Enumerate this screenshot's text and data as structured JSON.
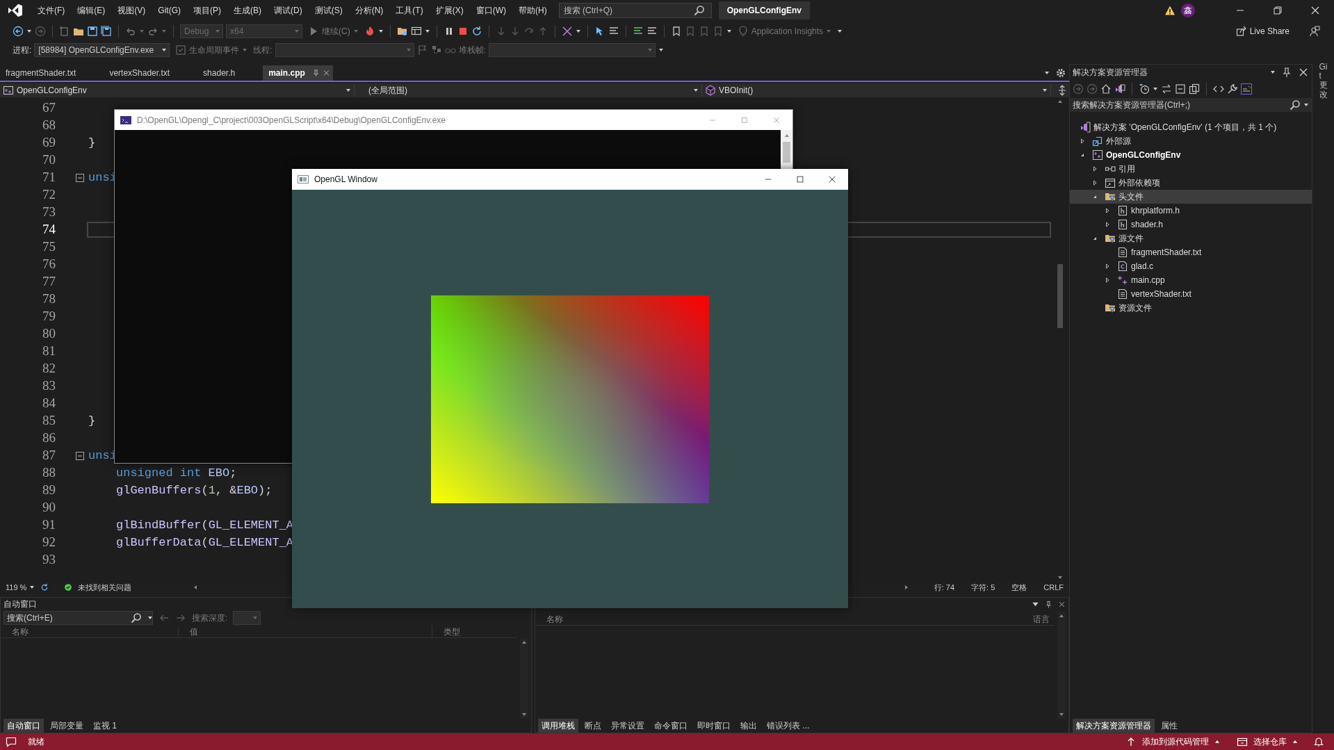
{
  "menu_bar": {
    "menus": [
      "文件(F)",
      "编辑(E)",
      "视图(V)",
      "Git(G)",
      "项目(P)",
      "生成(B)",
      "调试(D)",
      "测试(S)",
      "分析(N)",
      "工具(T)",
      "扩展(X)",
      "窗口(W)",
      "帮助(H)"
    ],
    "search": {
      "placeholder": "搜索 (Ctrl+Q)"
    },
    "solution_name": "OpenGLConfigEnv",
    "avatar": "鑫"
  },
  "toolbar": {
    "configuration": "Debug",
    "platform": "x64",
    "continue_button": "继续(C)",
    "insights": "Application Insights",
    "live_share": "Live Share"
  },
  "debug_location": {
    "process_label": "进程:",
    "process": "[58984] OpenGLConfigEnv.exe",
    "lifecycle_events": "生命周期事件",
    "thread_label": "线程:",
    "stack_frame_label": "堆栈帧:"
  },
  "tabs": [
    {
      "label": "fragmentShader.txt",
      "selected": false
    },
    {
      "label": "vertexShader.txt",
      "selected": false
    },
    {
      "label": "shader.h",
      "selected": false
    },
    {
      "label": "main.cpp",
      "selected": true
    }
  ],
  "navigation": {
    "project": "OpenGLConfigEnv",
    "scope": "(全局范围)",
    "member": "VBOInit()"
  },
  "editor": {
    "lines": [
      {
        "number": "67",
        "kind": "blank"
      },
      {
        "number": "68",
        "kind": "blank"
      },
      {
        "number": "69",
        "kind": "brace",
        "tokens": [
          {
            "text": "}",
            "kind": "punct"
          }
        ]
      },
      {
        "number": "70",
        "kind": "blank"
      },
      {
        "number": "71",
        "kind": "fold_start",
        "tokens": [
          {
            "text": "unsi",
            "kind": "keyword"
          }
        ]
      },
      {
        "number": "72",
        "kind": "blank"
      },
      {
        "number": "73",
        "kind": "blank"
      },
      {
        "number": "74",
        "kind": "current"
      },
      {
        "number": "75",
        "kind": "blank"
      },
      {
        "number": "76",
        "kind": "blank"
      },
      {
        "number": "77",
        "kind": "blank"
      },
      {
        "number": "78",
        "kind": "blank"
      },
      {
        "number": "79",
        "kind": "blank"
      },
      {
        "number": "80",
        "kind": "blank"
      },
      {
        "number": "81",
        "kind": "blank"
      },
      {
        "number": "82",
        "kind": "blank"
      },
      {
        "number": "83",
        "kind": "blank"
      },
      {
        "number": "84",
        "kind": "blank"
      },
      {
        "number": "85",
        "kind": "brace",
        "tokens": [
          {
            "text": "}",
            "kind": "punct"
          }
        ]
      },
      {
        "number": "86",
        "kind": "blank"
      },
      {
        "number": "87",
        "kind": "fold_start",
        "tokens": [
          {
            "text": "unsi",
            "kind": "keyword"
          }
        ]
      },
      {
        "number": "88",
        "kind": "body",
        "tokens": [
          {
            "text": "unsigned int",
            "kind": "keyword"
          },
          {
            "text": " EBO",
            "kind": "variable"
          },
          {
            "text": ";",
            "kind": "punct"
          }
        ]
      },
      {
        "number": "89",
        "kind": "body",
        "tokens": [
          {
            "text": "glGenBuffers",
            "kind": "function"
          },
          {
            "text": "(",
            "kind": "punct"
          },
          {
            "text": "1",
            "kind": "number"
          },
          {
            "text": ", &",
            "kind": "punct"
          },
          {
            "text": "EBO",
            "kind": "variable"
          },
          {
            "text": ");",
            "kind": "punct"
          }
        ]
      },
      {
        "number": "90",
        "kind": "blank"
      },
      {
        "number": "91",
        "kind": "body",
        "tokens": [
          {
            "text": "glBindBuffer",
            "kind": "function"
          },
          {
            "text": "(",
            "kind": "punct"
          },
          {
            "text": "GL_ELEMENT_A",
            "kind": "macro"
          }
        ]
      },
      {
        "number": "92",
        "kind": "body",
        "tokens": [
          {
            "text": "glBufferData",
            "kind": "function"
          },
          {
            "text": "(",
            "kind": "punct"
          },
          {
            "text": "GL_ELEMENT_A",
            "kind": "macro"
          }
        ]
      },
      {
        "number": "93",
        "kind": "blank"
      }
    ]
  },
  "editor_status": {
    "zoom": "119 %",
    "issues": "未找到相关问题",
    "line": "行: 74",
    "character": "字符: 5",
    "whitespace": "空格",
    "line_ending": "CRLF"
  },
  "autos_panel": {
    "title": "自动窗口",
    "search": {
      "placeholder": "搜索(Ctrl+E)"
    },
    "depth_label": "搜索深度:",
    "columns": [
      "名称",
      "值",
      "类型"
    ],
    "tabs": [
      {
        "label": "自动窗口",
        "selected": true
      },
      {
        "label": "局部变量",
        "selected": false
      },
      {
        "label": "监视 1",
        "selected": false
      }
    ]
  },
  "call_stack_panel": {
    "columns": [
      "名称",
      "语言"
    ],
    "tabs": [
      {
        "label": "调用堆栈",
        "selected": true
      },
      {
        "label": "断点",
        "selected": false
      },
      {
        "label": "异常设置",
        "selected": false
      },
      {
        "label": "命令窗口",
        "selected": false
      },
      {
        "label": "即时窗口",
        "selected": false
      },
      {
        "label": "输出",
        "selected": false
      },
      {
        "label": "错误列表 ...",
        "selected": false
      }
    ]
  },
  "solution_explorer": {
    "title": "解决方案资源管理器",
    "search": {
      "placeholder": "搜索解决方案资源管理器(Ctrl+;)"
    },
    "tree": [
      {
        "label": "解决方案 'OpenGLConfigEnv' (1 个项目，共 1 个)",
        "kind": "solution",
        "selected": false,
        "children": [
          {
            "label": "外部源",
            "kind": "external",
            "expanded": false,
            "selected": false
          },
          {
            "label": "OpenGLConfigEnv",
            "kind": "project",
            "expanded": true,
            "selected": false,
            "children": [
              {
                "label": "引用",
                "kind": "references",
                "expanded": false,
                "selected": false
              },
              {
                "label": "外部依赖项",
                "kind": "dependencies",
                "expanded": false,
                "selected": false
              },
              {
                "label": "头文件",
                "kind": "filter",
                "expanded": true,
                "selected": true,
                "children": [
                  {
                    "label": "khrplatform.h",
                    "kind": "header",
                    "expanded": false,
                    "selected": false
                  },
                  {
                    "label": "shader.h",
                    "kind": "header",
                    "expanded": false,
                    "selected": false
                  }
                ]
              },
              {
                "label": "源文件",
                "kind": "filter",
                "expanded": true,
                "selected": false,
                "children": [
                  {
                    "label": "fragmentShader.txt",
                    "kind": "text",
                    "selected": false
                  },
                  {
                    "label": "glad.c",
                    "kind": "c",
                    "expanded": false,
                    "selected": false
                  },
                  {
                    "label": "main.cpp",
                    "kind": "cpp",
                    "expanded": false,
                    "selected": false
                  },
                  {
                    "label": "vertexShader.txt",
                    "kind": "text",
                    "selected": false
                  }
                ]
              },
              {
                "label": "资源文件",
                "kind": "filter",
                "selected": false
              }
            ]
          }
        ]
      }
    ],
    "tabs": [
      {
        "label": "解决方案资源管理器",
        "selected": true
      },
      {
        "label": "属性",
        "selected": false
      }
    ]
  },
  "side_tab": "Git 更改",
  "status_bar": {
    "state": "就绪",
    "source_control": "添加到源代码管理",
    "repository": "选择仓库"
  },
  "console_window": {
    "title": "D:\\OpenGL\\Opengl_C\\project\\003OpenGLScript\\x64\\Debug\\OpenGLConfigEnv.exe"
  },
  "opengl_window": {
    "title": "OpenGL Window"
  }
}
